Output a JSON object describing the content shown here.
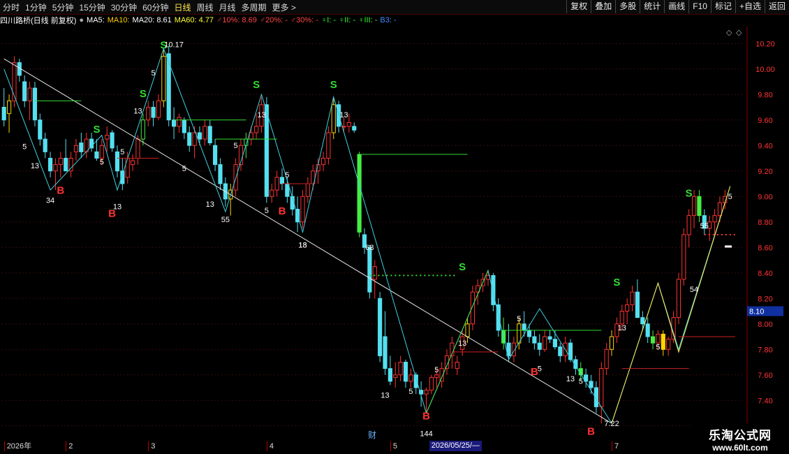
{
  "toolbar": {
    "periods": [
      "分时",
      "1分钟",
      "5分钟",
      "15分钟",
      "30分钟",
      "60分钟",
      "日线",
      "周线",
      "月线",
      "多周期",
      "更多 >"
    ],
    "active": "日线",
    "buttons": [
      "复权",
      "叠加",
      "多股",
      "统计",
      "画线",
      "F10",
      "标记",
      "+自选",
      "返回"
    ]
  },
  "infobar": {
    "stock": "四川路桥(日线 前复权)",
    "items": [
      {
        "text": "MA5:",
        "color": "#ffffff"
      },
      {
        "text": "MA10:",
        "color": "#ffcc00"
      },
      {
        "text": "MA20: 8.61",
        "color": "#ffffff"
      },
      {
        "text": "MA60: 4.77",
        "color": "#ffff33"
      },
      {
        "text": "♂10%: 8.69",
        "color": "#ff4444"
      },
      {
        "text": "♂20%: -",
        "color": "#ff4444"
      },
      {
        "text": "♂30%: -",
        "color": "#ff4444"
      },
      {
        "text": "♀I: -",
        "color": "#33ff33"
      },
      {
        "text": "♀II: -",
        "color": "#33ff33"
      },
      {
        "text": "♀III: -",
        "color": "#33ff33"
      },
      {
        "text": "B3: -",
        "color": "#4488ff"
      }
    ]
  },
  "chart_data": {
    "type": "candlestick",
    "yaxis": {
      "min": 7.1,
      "max": 10.3,
      "ticks": [
        7.2,
        7.4,
        7.6,
        7.8,
        8.0,
        8.2,
        8.4,
        8.6,
        8.8,
        9.0,
        9.2,
        9.4,
        9.6,
        9.8,
        10.0,
        10.2
      ]
    },
    "current_price": 8.1,
    "candles": [
      [
        9.7,
        9.85,
        9.55,
        9.6
      ],
      [
        9.65,
        9.8,
        9.5,
        9.75
      ],
      [
        9.75,
        10.1,
        9.7,
        10.05
      ],
      [
        10.05,
        10.08,
        9.9,
        9.95
      ],
      [
        9.9,
        9.95,
        9.7,
        9.75
      ],
      [
        9.75,
        9.9,
        9.6,
        9.85
      ],
      [
        9.85,
        9.9,
        9.55,
        9.6
      ],
      [
        9.6,
        9.65,
        9.4,
        9.45
      ],
      [
        9.45,
        9.5,
        9.3,
        9.35
      ],
      [
        9.3,
        9.35,
        9.15,
        9.2
      ],
      [
        9.2,
        9.3,
        9.05,
        9.25
      ],
      [
        9.25,
        9.35,
        9.15,
        9.3
      ],
      [
        9.3,
        9.45,
        9.2,
        9.2
      ],
      [
        9.2,
        9.35,
        9.15,
        9.3
      ],
      [
        9.35,
        9.45,
        9.28,
        9.4
      ],
      [
        9.42,
        9.5,
        9.3,
        9.35
      ],
      [
        9.35,
        9.5,
        9.3,
        9.45
      ],
      [
        9.45,
        9.5,
        9.35,
        9.38
      ],
      [
        9.35,
        9.45,
        9.28,
        9.3
      ],
      [
        9.3,
        9.45,
        9.25,
        9.4
      ],
      [
        9.45,
        9.55,
        9.35,
        9.48
      ],
      [
        9.5,
        9.52,
        9.35,
        9.38
      ],
      [
        9.35,
        9.4,
        9.15,
        9.2
      ],
      [
        9.2,
        9.3,
        9.05,
        9.1
      ],
      [
        9.15,
        9.35,
        9.1,
        9.3
      ],
      [
        9.25,
        9.33,
        9.2,
        9.28
      ],
      [
        9.3,
        9.48,
        9.25,
        9.45
      ],
      [
        9.45,
        9.65,
        9.4,
        9.6
      ],
      [
        9.6,
        9.75,
        9.55,
        9.7
      ],
      [
        9.7,
        9.75,
        9.55,
        9.62
      ],
      [
        9.62,
        9.8,
        9.6,
        9.75
      ],
      [
        9.75,
        10.15,
        9.7,
        10.1
      ],
      [
        10.12,
        10.18,
        9.55,
        9.6
      ],
      [
        9.6,
        9.7,
        9.45,
        9.55
      ],
      [
        9.55,
        9.65,
        9.5,
        9.62
      ],
      [
        9.6,
        9.62,
        9.45,
        9.5
      ],
      [
        9.5,
        9.55,
        9.35,
        9.4
      ],
      [
        9.4,
        9.55,
        9.3,
        9.5
      ],
      [
        9.5,
        9.55,
        9.4,
        9.45
      ],
      [
        9.45,
        9.6,
        9.4,
        9.55
      ],
      [
        9.55,
        9.6,
        9.4,
        9.42
      ],
      [
        9.4,
        9.45,
        9.2,
        9.25
      ],
      [
        9.25,
        9.3,
        9.05,
        9.1
      ],
      [
        9.1,
        9.15,
        8.92,
        8.98
      ],
      [
        8.98,
        9.1,
        8.85,
        9.05
      ],
      [
        9.05,
        9.3,
        9.0,
        9.25
      ],
      [
        9.25,
        9.45,
        9.2,
        9.4
      ],
      [
        9.4,
        9.5,
        9.3,
        9.45
      ],
      [
        9.45,
        9.55,
        9.4,
        9.5
      ],
      [
        9.5,
        9.65,
        9.45,
        9.55
      ],
      [
        9.55,
        9.78,
        9.5,
        9.72
      ],
      [
        9.72,
        9.78,
        8.95,
        9.0
      ],
      [
        9.0,
        9.1,
        8.95,
        9.05
      ],
      [
        9.05,
        9.2,
        9.0,
        9.15
      ],
      [
        9.15,
        9.22,
        9.05,
        9.1
      ],
      [
        9.1,
        9.15,
        8.95,
        9.0
      ],
      [
        9.0,
        9.08,
        8.85,
        8.9
      ],
      [
        8.9,
        9.0,
        8.72,
        8.8
      ],
      [
        8.8,
        9.05,
        8.75,
        9.0
      ],
      [
        9.0,
        9.15,
        8.95,
        9.1
      ],
      [
        9.1,
        9.25,
        9.05,
        9.2
      ],
      [
        9.2,
        9.3,
        9.1,
        9.25
      ],
      [
        9.25,
        9.35,
        9.2,
        9.3
      ],
      [
        9.3,
        9.55,
        9.25,
        9.5
      ],
      [
        9.5,
        9.78,
        9.45,
        9.72
      ],
      [
        9.72,
        9.75,
        9.5,
        9.55
      ],
      [
        9.55,
        9.62,
        9.5,
        9.55
      ],
      [
        9.55,
        9.65,
        9.5,
        9.58
      ],
      [
        9.55,
        9.58,
        9.5,
        9.52
      ],
      [
        9.33,
        9.35,
        8.68,
        8.72
      ],
      [
        8.7,
        8.75,
        8.55,
        8.6
      ],
      [
        8.6,
        8.62,
        8.2,
        8.25
      ],
      [
        8.35,
        8.5,
        8.2,
        8.45
      ],
      [
        8.2,
        8.25,
        7.7,
        7.75
      ],
      [
        7.9,
        8.1,
        7.6,
        7.65
      ],
      [
        7.65,
        7.75,
        7.52,
        7.55
      ],
      [
        7.58,
        7.7,
        7.5,
        7.6
      ],
      [
        7.6,
        7.75,
        7.55,
        7.7
      ],
      [
        7.7,
        7.72,
        7.5,
        7.55
      ],
      [
        7.55,
        7.65,
        7.5,
        7.6
      ],
      [
        7.6,
        7.62,
        7.45,
        7.5
      ],
      [
        7.48,
        7.55,
        7.35,
        7.45
      ],
      [
        7.45,
        7.5,
        7.3,
        7.48
      ],
      [
        7.48,
        7.6,
        7.45,
        7.58
      ],
      [
        7.58,
        7.65,
        7.5,
        7.6
      ],
      [
        7.55,
        7.7,
        7.5,
        7.65
      ],
      [
        7.65,
        7.8,
        7.6,
        7.75
      ],
      [
        7.75,
        7.9,
        7.65,
        7.85
      ],
      [
        7.65,
        7.75,
        7.6,
        7.7
      ],
      [
        7.8,
        7.95,
        7.75,
        7.9
      ],
      [
        7.9,
        8.05,
        7.85,
        8.0
      ],
      [
        8.0,
        8.3,
        7.95,
        8.25
      ],
      [
        8.25,
        8.35,
        8.15,
        8.3
      ],
      [
        8.3,
        8.4,
        8.25,
        8.35
      ],
      [
        8.35,
        8.42,
        8.3,
        8.38
      ],
      [
        8.38,
        8.4,
        8.1,
        8.15
      ],
      [
        8.15,
        8.2,
        7.9,
        7.95
      ],
      [
        7.95,
        8.05,
        7.8,
        7.85
      ],
      [
        7.85,
        8.0,
        7.7,
        7.75
      ],
      [
        7.75,
        7.9,
        7.7,
        7.85
      ],
      [
        7.85,
        8.05,
        7.8,
        8.0
      ],
      [
        8.0,
        8.1,
        7.9,
        7.95
      ],
      [
        7.95,
        8.0,
        7.85,
        7.9
      ],
      [
        7.9,
        7.95,
        7.8,
        7.85
      ],
      [
        7.85,
        7.92,
        7.75,
        7.8
      ],
      [
        7.8,
        7.95,
        7.78,
        7.9
      ],
      [
        7.9,
        7.95,
        7.85,
        7.88
      ],
      [
        7.88,
        7.95,
        7.8,
        7.82
      ],
      [
        7.82,
        7.85,
        7.7,
        7.75
      ],
      [
        7.75,
        7.9,
        7.7,
        7.85
      ],
      [
        7.85,
        7.88,
        7.7,
        7.72
      ],
      [
        7.72,
        7.75,
        7.6,
        7.65
      ],
      [
        7.65,
        7.7,
        7.55,
        7.6
      ],
      [
        7.6,
        7.65,
        7.5,
        7.55
      ],
      [
        7.55,
        7.6,
        7.45,
        7.5
      ],
      [
        7.5,
        7.55,
        7.3,
        7.35
      ],
      [
        7.35,
        7.7,
        7.22,
        7.65
      ],
      [
        7.65,
        7.85,
        7.6,
        7.8
      ],
      [
        7.8,
        7.95,
        7.75,
        7.9
      ],
      [
        7.9,
        8.05,
        7.85,
        8.0
      ],
      [
        8.0,
        8.15,
        7.95,
        8.1
      ],
      [
        8.1,
        8.2,
        8.0,
        8.15
      ],
      [
        8.15,
        8.3,
        8.1,
        8.25
      ],
      [
        8.25,
        8.35,
        8.15,
        8.05
      ],
      [
        8.05,
        8.1,
        7.95,
        8.0
      ],
      [
        8.0,
        8.05,
        7.85,
        7.9
      ],
      [
        7.9,
        7.95,
        7.8,
        7.85
      ],
      [
        7.85,
        7.95,
        7.8,
        7.92
      ],
      [
        7.92,
        7.95,
        7.75,
        7.8
      ],
      [
        7.8,
        7.9,
        7.75,
        7.88
      ],
      [
        7.88,
        8.1,
        7.85,
        8.05
      ],
      [
        8.05,
        8.4,
        8.0,
        8.35
      ],
      [
        8.35,
        8.75,
        8.3,
        8.7
      ],
      [
        8.7,
        8.9,
        8.6,
        8.85
      ],
      [
        8.85,
        9.05,
        8.75,
        9.0
      ],
      [
        9.0,
        9.05,
        8.8,
        8.85
      ],
      [
        8.85,
        8.9,
        8.7,
        8.75
      ],
      [
        8.75,
        8.85,
        8.65,
        8.8
      ],
      [
        8.8,
        8.9,
        8.7,
        8.85
      ],
      [
        8.85,
        9.0,
        8.8,
        8.95
      ],
      [
        8.95,
        9.05,
        8.9,
        9.0
      ]
    ],
    "annotations": [
      {
        "t": "S",
        "c": "#33dd33",
        "i": 31,
        "p": 10.16,
        "size": 15
      },
      {
        "t": "10.17",
        "c": "#ffffff",
        "i": 33,
        "p": 10.17,
        "size": 11
      },
      {
        "t": "S",
        "c": "#33dd33",
        "i": 27,
        "p": 9.78,
        "size": 15
      },
      {
        "t": "S",
        "c": "#33dd33",
        "i": 18,
        "p": 9.5,
        "size": 15
      },
      {
        "t": "S",
        "c": "#33dd33",
        "i": 49,
        "p": 9.85,
        "size": 15
      },
      {
        "t": "S",
        "c": "#33dd33",
        "i": 64,
        "p": 9.85,
        "size": 15
      },
      {
        "t": "S",
        "c": "#33dd33",
        "i": 89,
        "p": 8.42,
        "size": 15
      },
      {
        "t": "S",
        "c": "#33dd33",
        "i": 119,
        "p": 8.3,
        "size": 15
      },
      {
        "t": "S",
        "c": "#33dd33",
        "i": 133,
        "p": 9.0,
        "size": 15
      },
      {
        "t": "B",
        "c": "#ff3333",
        "i": 11,
        "p": 9.02,
        "size": 15
      },
      {
        "t": "B",
        "c": "#ff3333",
        "i": 21,
        "p": 8.84,
        "size": 15
      },
      {
        "t": "B",
        "c": "#ff3333",
        "i": 54,
        "p": 8.86,
        "size": 15
      },
      {
        "t": "B",
        "c": "#ff3333",
        "i": 82,
        "p": 7.25,
        "size": 15
      },
      {
        "t": "B",
        "c": "#ff3333",
        "i": 103,
        "p": 7.6,
        "size": 15
      },
      {
        "t": "B",
        "c": "#ff3333",
        "i": 114,
        "p": 7.13,
        "size": 15
      },
      {
        "t": "34",
        "c": "#ffffff",
        "i": 9,
        "p": 8.95,
        "size": 11
      },
      {
        "t": "13",
        "c": "#ffffff",
        "i": 22,
        "p": 8.9,
        "size": 11
      },
      {
        "t": "13",
        "c": "#ffffff",
        "i": 6,
        "p": 9.22,
        "size": 11
      },
      {
        "t": "5",
        "c": "#ffffff",
        "i": 4,
        "p": 9.37,
        "size": 11
      },
      {
        "t": "55",
        "c": "#ffffff",
        "i": 43,
        "p": 8.8,
        "size": 11
      },
      {
        "t": "13",
        "c": "#ffffff",
        "i": 40,
        "p": 8.92,
        "size": 11
      },
      {
        "t": "5",
        "c": "#ffffff",
        "i": 35,
        "p": 9.2,
        "size": 11
      },
      {
        "t": "5",
        "c": "#ffffff",
        "i": 51,
        "p": 8.87,
        "size": 11
      },
      {
        "t": "5",
        "c": "#ffffff",
        "i": 55,
        "p": 9.15,
        "size": 11
      },
      {
        "t": "13",
        "c": "#ffffff",
        "i": 58,
        "p": 8.6,
        "size": 11
      },
      {
        "t": "13",
        "c": "#ffffff",
        "i": 50,
        "p": 9.62,
        "size": 11
      },
      {
        "t": "13",
        "c": "#ffffff",
        "i": 66,
        "p": 9.62,
        "size": 11
      },
      {
        "t": "5",
        "c": "#ffffff",
        "i": 29,
        "p": 9.95,
        "size": 11
      },
      {
        "t": "13",
        "c": "#ffffff",
        "i": 26,
        "p": 9.65,
        "size": 11
      },
      {
        "t": "5",
        "c": "#ffffff",
        "i": 45,
        "p": 9.38,
        "size": 11
      },
      {
        "t": "5",
        "c": "#ffffff",
        "i": 19,
        "p": 9.25,
        "size": 11
      },
      {
        "t": "5",
        "c": "#ffffff",
        "i": 23,
        "p": 9.33,
        "size": 11
      },
      {
        "t": "13",
        "c": "#ffffff",
        "i": 74,
        "p": 7.42,
        "size": 11
      },
      {
        "t": "5",
        "c": "#ffffff",
        "i": 79,
        "p": 7.45,
        "size": 11
      },
      {
        "t": "144",
        "c": "#ffffff",
        "i": 82,
        "p": 7.12,
        "size": 11
      },
      {
        "t": "5",
        "c": "#ffffff",
        "i": 84,
        "p": 7.62,
        "size": 11
      },
      {
        "t": "13",
        "c": "#ffffff",
        "i": 89,
        "p": 7.83,
        "size": 11
      },
      {
        "t": "5",
        "c": "#ffffff",
        "i": 100,
        "p": 8.02,
        "size": 11
      },
      {
        "t": "5",
        "c": "#ffffff",
        "i": 104,
        "p": 7.63,
        "size": 11
      },
      {
        "t": "13",
        "c": "#ffffff",
        "i": 110,
        "p": 7.55,
        "size": 11
      },
      {
        "t": "5",
        "c": "#ffffff",
        "i": 112,
        "p": 7.53,
        "size": 11
      },
      {
        "t": "7.22",
        "c": "#ffffff",
        "i": 118,
        "p": 7.2,
        "size": 11
      },
      {
        "t": "13",
        "c": "#ffffff",
        "i": 120,
        "p": 7.95,
        "size": 11
      },
      {
        "t": "5",
        "c": "#ffffff",
        "i": 127,
        "p": 7.8,
        "size": 11
      },
      {
        "t": "54",
        "c": "#ffffff",
        "i": 134,
        "p": 8.25,
        "size": 11
      },
      {
        "t": "55",
        "c": "#ffffff",
        "i": 136,
        "p": 8.75,
        "size": 11
      },
      {
        "t": "5",
        "c": "#ffffff",
        "i": 141,
        "p": 8.98,
        "size": 11
      },
      {
        "t": "68",
        "c": "#ffffff",
        "i": 71,
        "p": 8.58,
        "size": 11
      },
      {
        "t": "18",
        "c": "#ffffff",
        "i": 58,
        "p": 8.6,
        "size": 11
      }
    ],
    "time_ticks": [
      {
        "t": "2026年",
        "i": 0
      },
      {
        "t": "2",
        "i": 12
      },
      {
        "t": "3",
        "i": 28
      },
      {
        "t": "4",
        "i": 51
      },
      {
        "t": "5",
        "i": 75
      },
      {
        "t": "7",
        "i": 118
      }
    ],
    "time_cursor": {
      "t": "2026/05/25/—",
      "i": 88
    },
    "fin_marker": "财",
    "brand": {
      "cn": "乐淘公式网",
      "url": "www.60lt.com"
    }
  }
}
